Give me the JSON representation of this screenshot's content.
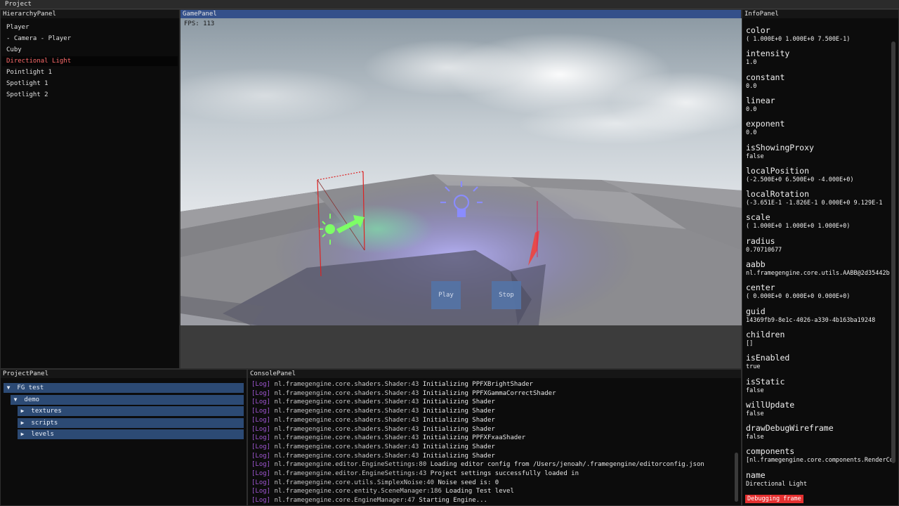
{
  "menu": {
    "project": "Project"
  },
  "hierarchy": {
    "title": "HierarchyPanel",
    "items": [
      "Player",
      "- Camera - Player",
      "Cuby",
      "Directional Light",
      "Pointlight 1",
      "Spotlight 1",
      "Spotlight 2"
    ],
    "selected_index": 3,
    "selected_color": "#ff6b6b"
  },
  "game": {
    "title": "GamePanel",
    "fps": "FPS: 113",
    "play_label": "Play",
    "stop_label": "Stop"
  },
  "info": {
    "title": "InfoPanel",
    "properties": [
      {
        "key": "color",
        "value": "( 1.000E+0  1.000E+0  7.500E-1)"
      },
      {
        "key": "intensity",
        "value": "1.0"
      },
      {
        "key": "constant",
        "value": "0.0"
      },
      {
        "key": "linear",
        "value": "0.0"
      },
      {
        "key": "exponent",
        "value": "0.0"
      },
      {
        "key": "isShowingProxy",
        "value": "false"
      },
      {
        "key": "localPosition",
        "value": "(-2.500E+0  6.500E+0 -4.000E+0)"
      },
      {
        "key": "localRotation",
        "value": "(-3.651E-1 -1.826E-1  0.000E+0  9.129E-1"
      },
      {
        "key": "scale",
        "value": "( 1.000E+0  1.000E+0  1.000E+0)"
      },
      {
        "key": "radius",
        "value": "0.70710677"
      },
      {
        "key": "aabb",
        "value": "nl.framegengine.core.utils.AABB@2d35442b"
      },
      {
        "key": "center",
        "value": "( 0.000E+0  0.000E+0  0.000E+0)"
      },
      {
        "key": "guid",
        "value": "14369fb9-8e1c-4026-a330-4b163ba19248"
      },
      {
        "key": "children",
        "value": "[]"
      },
      {
        "key": "isEnabled",
        "value": "true"
      },
      {
        "key": "isStatic",
        "value": "false"
      },
      {
        "key": "willUpdate",
        "value": "false"
      },
      {
        "key": "drawDebugWireframe",
        "value": "false"
      },
      {
        "key": "components",
        "value": "[nl.framegengine.core.components.RenderCo"
      },
      {
        "key": "name",
        "value": "Directional Light"
      }
    ],
    "debug_label": "Debugging frame"
  },
  "project": {
    "title": "ProjectPanel",
    "tree": [
      {
        "label": "FG test",
        "depth": 0,
        "expanded": true
      },
      {
        "label": "demo",
        "depth": 1,
        "expanded": true
      },
      {
        "label": "textures",
        "depth": 2,
        "expanded": false
      },
      {
        "label": "scripts",
        "depth": 2,
        "expanded": false
      },
      {
        "label": "levels",
        "depth": 2,
        "expanded": false
      }
    ]
  },
  "console": {
    "title": "ConsolePanel",
    "tag": "[Log]",
    "lines": [
      {
        "src": "nl.framegengine.core.shaders.Shader:43",
        "msg": "Initializing PPFXBrightShader"
      },
      {
        "src": "nl.framegengine.core.shaders.Shader:43",
        "msg": "Initializing PPFXGammaCorrectShader"
      },
      {
        "src": "nl.framegengine.core.shaders.Shader:43",
        "msg": "Initializing Shader"
      },
      {
        "src": "nl.framegengine.core.shaders.Shader:43",
        "msg": "Initializing Shader"
      },
      {
        "src": "nl.framegengine.core.shaders.Shader:43",
        "msg": "Initializing Shader"
      },
      {
        "src": "nl.framegengine.core.shaders.Shader:43",
        "msg": "Initializing Shader"
      },
      {
        "src": "nl.framegengine.core.shaders.Shader:43",
        "msg": "Initializing PPFXFxaaShader"
      },
      {
        "src": "nl.framegengine.core.shaders.Shader:43",
        "msg": "Initializing Shader"
      },
      {
        "src": "nl.framegengine.core.shaders.Shader:43",
        "msg": "Initializing Shader"
      },
      {
        "src": "nl.framegengine.editor.EngineSettings:80",
        "msg": "Loading editor config from /Users/jenoah/.framegengine/editorconfig.json"
      },
      {
        "src": "nl.framegengine.editor.EngineSettings:43",
        "msg": "Project settings successfully loaded in"
      },
      {
        "src": "nl.framegengine.core.utils.SimplexNoise:40",
        "msg": "Noise seed is: 0"
      },
      {
        "src": "nl.framegengine.core.entity.SceneManager:186",
        "msg": "Loading Test level"
      },
      {
        "src": "nl.framegengine.core.EngineManager:47",
        "msg": "Starting Engine..."
      }
    ]
  }
}
